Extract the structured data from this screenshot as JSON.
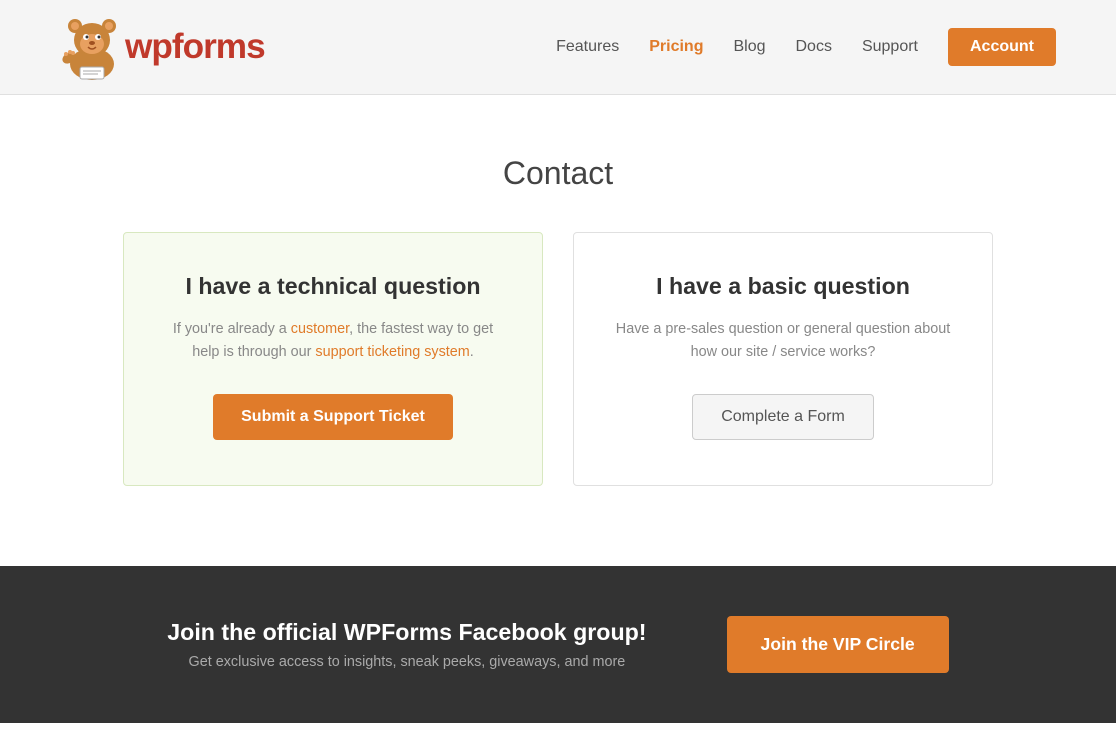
{
  "header": {
    "logo_text_wp": "wp",
    "logo_text_forms": "forms",
    "nav": {
      "features": "Features",
      "pricing": "Pricing",
      "blog": "Blog",
      "docs": "Docs",
      "support": "Support",
      "account": "Account"
    }
  },
  "main": {
    "contact_title": "Contact",
    "card_technical": {
      "title": "I have a technical question",
      "description": "If you're already a customer, the fastest way to get help is through our support ticketing system.",
      "button_label": "Submit a Support Ticket"
    },
    "card_basic": {
      "title": "I have a basic question",
      "description": "Have a pre-sales question or general question about how our site / service works?",
      "button_label": "Complete a Form"
    }
  },
  "cta_bar": {
    "title": "Join the official WPForms Facebook group!",
    "subtitle": "Get exclusive access to insights, sneak peeks, giveaways, and more",
    "button_label": "Join the VIP Circle"
  }
}
